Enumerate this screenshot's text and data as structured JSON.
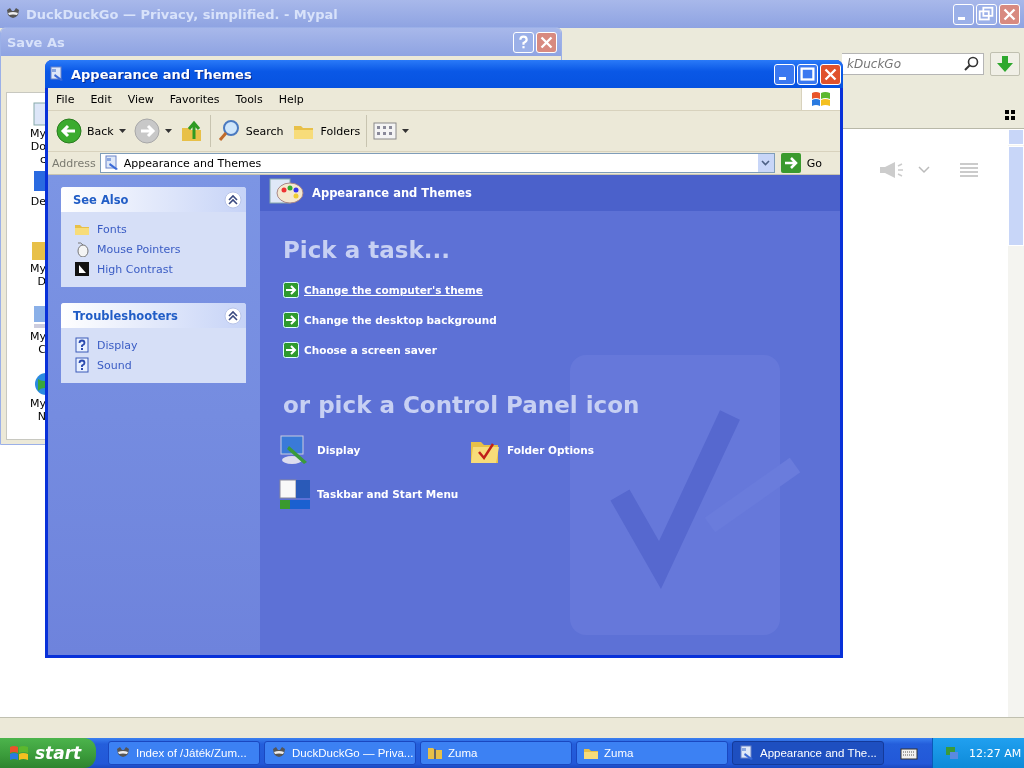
{
  "browser": {
    "title": "DuckDuckGo — Privacy, simplified. - Mypal",
    "search": {
      "placeholder": "kDuckGo"
    }
  },
  "save_as": {
    "title": "Save As",
    "places": [
      {
        "label": "My Doc",
        "kind": "docs"
      },
      {
        "label": "De",
        "kind": "desktop"
      },
      {
        "label": "My D",
        "kind": "folder"
      },
      {
        "label": "My C",
        "kind": "computer"
      },
      {
        "label": "My N",
        "kind": "network"
      }
    ]
  },
  "explorer": {
    "title": "Appearance and Themes",
    "menu": [
      "File",
      "Edit",
      "View",
      "Favorites",
      "Tools",
      "Help"
    ],
    "toolbar": [
      {
        "kind": "back",
        "label": "Back"
      },
      {
        "kind": "forward"
      },
      {
        "kind": "up"
      },
      {
        "kind": "search",
        "label": "Search"
      },
      {
        "kind": "folders",
        "label": "Folders"
      },
      {
        "kind": "views"
      }
    ],
    "address": {
      "label": "Address",
      "value": "Appearance and Themes",
      "go": "Go"
    },
    "side_panels": [
      {
        "title": "See Also",
        "items": [
          {
            "label": "Fonts",
            "kind": "folder"
          },
          {
            "label": "Mouse Pointers",
            "kind": "mouse"
          },
          {
            "label": "High Contrast",
            "kind": "contrast"
          }
        ]
      },
      {
        "title": "Troubleshooters",
        "items": [
          {
            "label": "Display",
            "kind": "help"
          },
          {
            "label": "Sound",
            "kind": "help"
          }
        ]
      }
    ],
    "header": "Appearance and Themes",
    "task_heading": "Pick a task...",
    "tasks": [
      {
        "label": "Change the computer's theme",
        "hovered": true
      },
      {
        "label": "Change the desktop background",
        "hovered": false
      },
      {
        "label": "Choose a screen saver",
        "hovered": false
      }
    ],
    "icon_heading": "or pick a Control Panel icon",
    "icons": [
      {
        "label": "Display",
        "kind": "display"
      },
      {
        "label": "Folder Options",
        "kind": "folder"
      },
      {
        "label": "Taskbar and Start Menu",
        "kind": "taskbar"
      }
    ]
  },
  "taskbar": {
    "start": "start",
    "tasks": [
      {
        "label": "Index of /Játék/Zum...",
        "kind": "browser",
        "selected": false
      },
      {
        "label": "DuckDuckGo — Priva...",
        "kind": "browser",
        "selected": false
      },
      {
        "label": "Zuma",
        "kind": "zip",
        "selected": false
      },
      {
        "label": "Zuma",
        "kind": "folder",
        "selected": false
      },
      {
        "label": "Appearance and The...",
        "kind": "panel",
        "selected": true
      }
    ],
    "clock": "12:27 AM"
  }
}
